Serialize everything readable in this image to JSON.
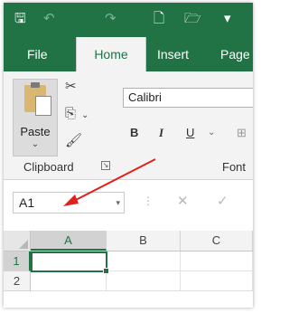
{
  "title_bar": {
    "icons": [
      "save-icon",
      "undo-icon",
      "redo-icon",
      "new-document-icon",
      "open-folder-icon",
      "customize-qat-icon"
    ],
    "glyphs": {
      "save": "🖫",
      "undo": "↶",
      "redo": "↷",
      "new": "🗋",
      "open": "🗁",
      "qat": "▾"
    }
  },
  "tabs": [
    {
      "label": "File"
    },
    {
      "label": "Home",
      "active": true
    },
    {
      "label": "Insert"
    },
    {
      "label": "Page L"
    }
  ],
  "ribbon": {
    "clipboard": {
      "paste_label": "Paste",
      "paste_chevron": "⌄",
      "cut_glyph": "✂",
      "copy_glyph": "⎘",
      "copy_chevron": "⌄",
      "format_painter_glyph": "🖌",
      "group_label": "Clipboard",
      "launcher_glyph": "↘"
    },
    "font": {
      "font_name": "Calibri",
      "bold": "B",
      "italic": "I",
      "underline": "U",
      "underline_chevron": "⌄",
      "borders_glyph": "⊞",
      "group_label": "Font"
    }
  },
  "formula_bar": {
    "name_box_value": "A1",
    "name_box_chevron": "▾",
    "dots": "⋮",
    "cancel_glyph": "✕",
    "enter_glyph": "✓"
  },
  "grid": {
    "columns": [
      "A",
      "B",
      "C"
    ],
    "rows": [
      "1",
      "2"
    ],
    "active_cell": "A1"
  },
  "colors": {
    "accent_green": "#217346",
    "annotation_arrow": "#e0201a"
  }
}
